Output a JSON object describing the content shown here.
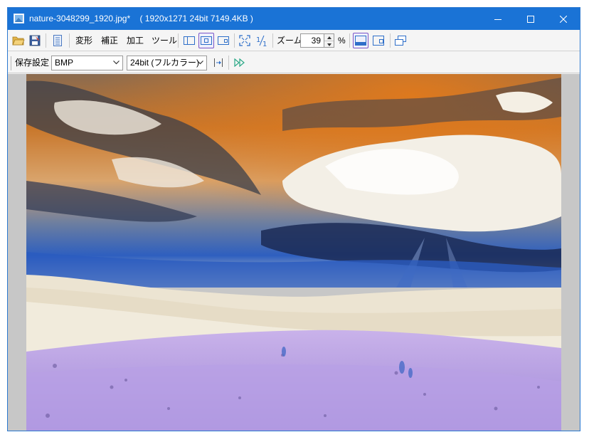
{
  "window": {
    "title": "nature-3048299_1920.jpg*",
    "meta": "( 1920x1271  24bit  7149.4KB )"
  },
  "toolbar": {
    "menu_transform": "変形",
    "menu_correct": "補正",
    "menu_process": "加工",
    "menu_tools": "ツール",
    "zoom_label": "ズーム:",
    "zoom_value": "39",
    "zoom_unit": "%"
  },
  "save_bar": {
    "label": "保存設定",
    "format": "BMP",
    "depth": "24bit (フルカラー)"
  },
  "colors": {
    "titlebar": "#1a73d6",
    "accent": "#7b55c8",
    "icon_blue": "#2f6fc9"
  }
}
